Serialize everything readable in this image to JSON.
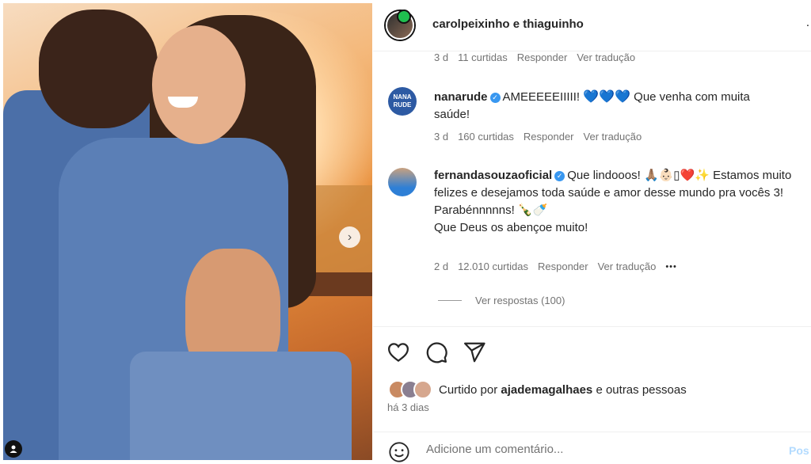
{
  "header": {
    "account_names": "carolpeixinho e thiaguinho",
    "more_icon": "ellipsis-icon"
  },
  "comments": [
    {
      "meta": {
        "age": "3 d",
        "likes": "11 curtidas",
        "reply": "Responder",
        "translate": "Ver tradução"
      }
    },
    {
      "username": "nanarude",
      "avatar_text": "NANA RUDE",
      "verified": true,
      "text_before": "AMEEEEEIIIII!",
      "emojis": "💙💙💙",
      "text_after": "Que venha com muita saúde!",
      "meta": {
        "age": "3 d",
        "likes": "160 curtidas",
        "reply": "Responder",
        "translate": "Ver tradução"
      }
    },
    {
      "username": "fernandasouzaoficial",
      "verified": true,
      "text_before": "Que lindooos!",
      "emojis": "🙏🏽👶🏻▯❤️✨",
      "text_line1": "Estamos muito felizes e desejamos toda saúde e amor desse mundo pra vocês 3!",
      "text_line2": "Parabénnnnns!",
      "text_line2_emojis": "🍾🍼",
      "text_line3": "Que Deus os abençoe muito!",
      "meta": {
        "age": "2 d",
        "likes": "12.010 curtidas",
        "reply": "Responder",
        "translate": "Ver tradução",
        "more": "•••"
      },
      "view_replies": "Ver respostas (100)"
    }
  ],
  "actions": {
    "like_icon": "heart-icon",
    "comment_icon": "comment-icon",
    "share_icon": "paper-plane-icon"
  },
  "likes_summary": {
    "prefix": "Curtido por",
    "user": "ajademagalhaes",
    "suffix": "e outras pessoas",
    "date": "há 3 dias"
  },
  "add_comment": {
    "placeholder": "Adicione um comentário...",
    "post_label": "Pos",
    "emoji_icon": "smiley-icon"
  },
  "colors": {
    "verified": "#3897f0",
    "text": "#262626",
    "muted": "#737373",
    "post_disabled": "#b3dbff"
  }
}
